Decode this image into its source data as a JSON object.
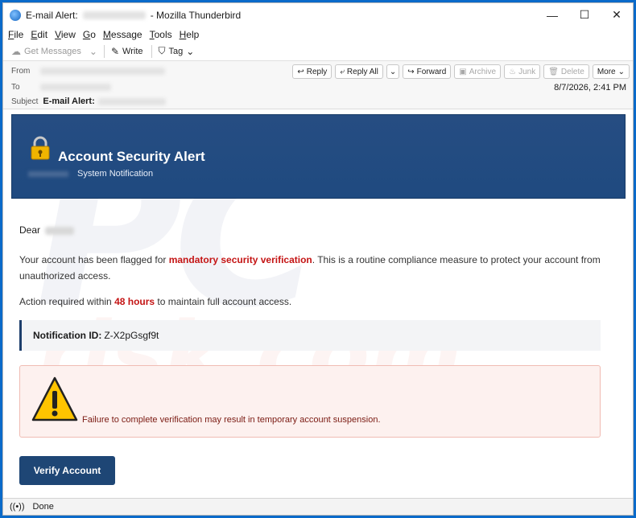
{
  "window": {
    "title_prefix": "E-mail Alert:",
    "title_suffix": "- Mozilla Thunderbird",
    "controls": [
      "—",
      "☐",
      "✕"
    ]
  },
  "menu": [
    {
      "label": "File",
      "u": "F",
      "rest": "ile"
    },
    {
      "label": "Edit",
      "u": "E",
      "rest": "dit"
    },
    {
      "label": "View",
      "u": "V",
      "rest": "iew"
    },
    {
      "label": "Go",
      "u": "G",
      "rest": "o"
    },
    {
      "label": "Message",
      "u": "M",
      "rest": "essage"
    },
    {
      "label": "Tools",
      "u": "T",
      "rest": "ools"
    },
    {
      "label": "Help",
      "u": "H",
      "rest": "elp"
    }
  ],
  "toolbar": {
    "get_messages": "Get Messages",
    "write": "Write",
    "tag": "Tag"
  },
  "header": {
    "from_label": "From",
    "to_label": "To",
    "subject_label": "Subject",
    "subject": "E-mail Alert:",
    "date": "8/7/2026, 2:41 PM",
    "actions": {
      "reply": "Reply",
      "reply_all": "Reply All",
      "forward": "Forward",
      "archive": "Archive",
      "junk": "Junk",
      "delete": "Delete",
      "more": "More"
    }
  },
  "email": {
    "banner_title": "Account Security Alert",
    "banner_subtitle": "System Notification",
    "greeting": "Dear",
    "p1_before": "Your account has been flagged for ",
    "p1_highlight": "mandatory security verification",
    "p1_after": ". This is a routine compliance measure to protect your account from unauthorized access.",
    "p2_before": "Action required within ",
    "p2_highlight": "48 hours",
    "p2_after": " to maintain full account access.",
    "notif_label": "Notification ID:",
    "notif_value": "Z-X2pGsgf9t",
    "warning_text": "Failure to complete verification may result in temporary account suspension.",
    "verify_button": "Verify Account"
  },
  "watermark": {
    "top": "PC",
    "bottom": "risk.com"
  },
  "status": {
    "text": "Done"
  },
  "colors": {
    "banner": "#264d82",
    "alert_red": "#c41414",
    "button": "#1e4675",
    "warning_bg": "#fdf1ef"
  }
}
